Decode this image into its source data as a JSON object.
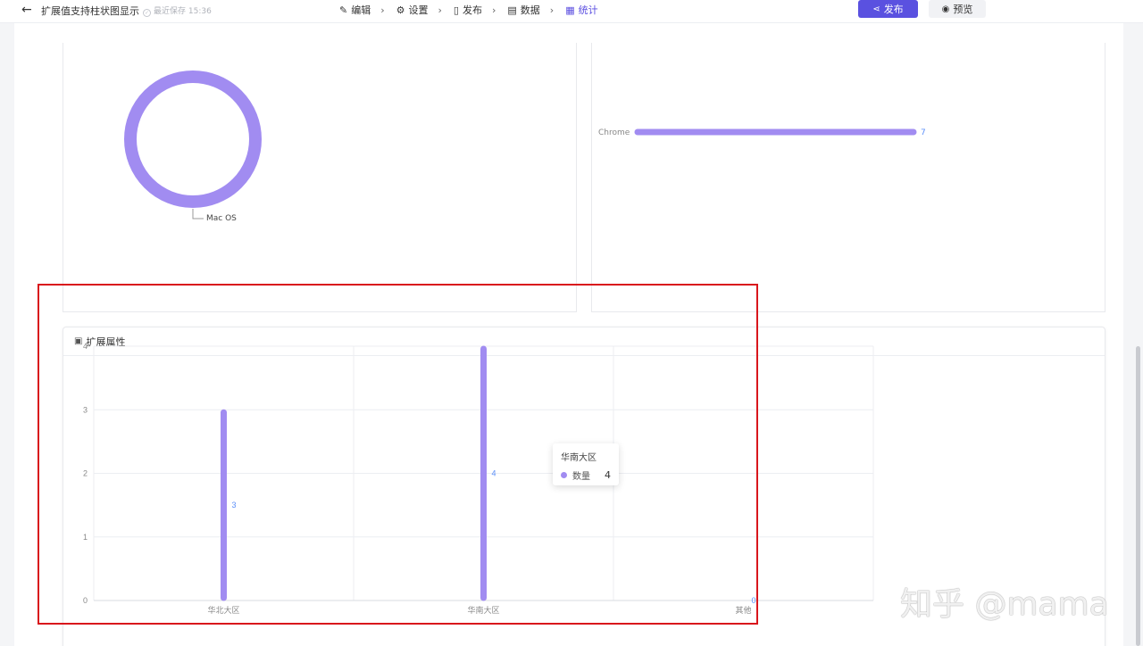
{
  "topbar": {
    "back_icon": "arrow-left-icon",
    "title": "扩展值支持柱状图显示",
    "saved_text": "最近保存 15:36",
    "nav": [
      {
        "label": "编辑",
        "icon": "edit-icon",
        "glyph": "✎"
      },
      {
        "label": "设置",
        "icon": "gear-icon",
        "glyph": "⚙"
      },
      {
        "label": "发布",
        "icon": "publish-icon",
        "glyph": "▯"
      },
      {
        "label": "数据",
        "icon": "document-icon",
        "glyph": "▤"
      },
      {
        "label": "统计",
        "icon": "stats-icon",
        "glyph": "▦"
      }
    ],
    "publish_label": "发布",
    "preview_label": "预览"
  },
  "cards": {
    "donut_legend": "Mac OS",
    "browser_label": "Chrome",
    "browser_value": "7",
    "bottom_title": "扩展属性"
  },
  "tooltip": {
    "title": "华南大区",
    "series_label": "数量",
    "value": "4"
  },
  "watermark": "知乎 @mama",
  "colors": {
    "accent": "#5a51e0",
    "bar": "#a18cf1",
    "value_label": "#5b8ff9",
    "highlight": "#d9161c"
  },
  "chart_data": [
    {
      "type": "pie",
      "categories": [
        "Mac OS"
      ],
      "values": [
        1
      ]
    },
    {
      "type": "bar",
      "orientation": "horizontal",
      "categories": [
        "Chrome"
      ],
      "values": [
        7
      ]
    },
    {
      "type": "bar",
      "title": "扩展属性",
      "categories": [
        "华北大区",
        "华南大区",
        "其他"
      ],
      "series": [
        {
          "name": "数量",
          "values": [
            3,
            4,
            0
          ]
        }
      ],
      "yticks": [
        "0",
        "1",
        "2",
        "3",
        "4"
      ],
      "ylim": [
        0,
        4
      ],
      "grid": true
    }
  ]
}
